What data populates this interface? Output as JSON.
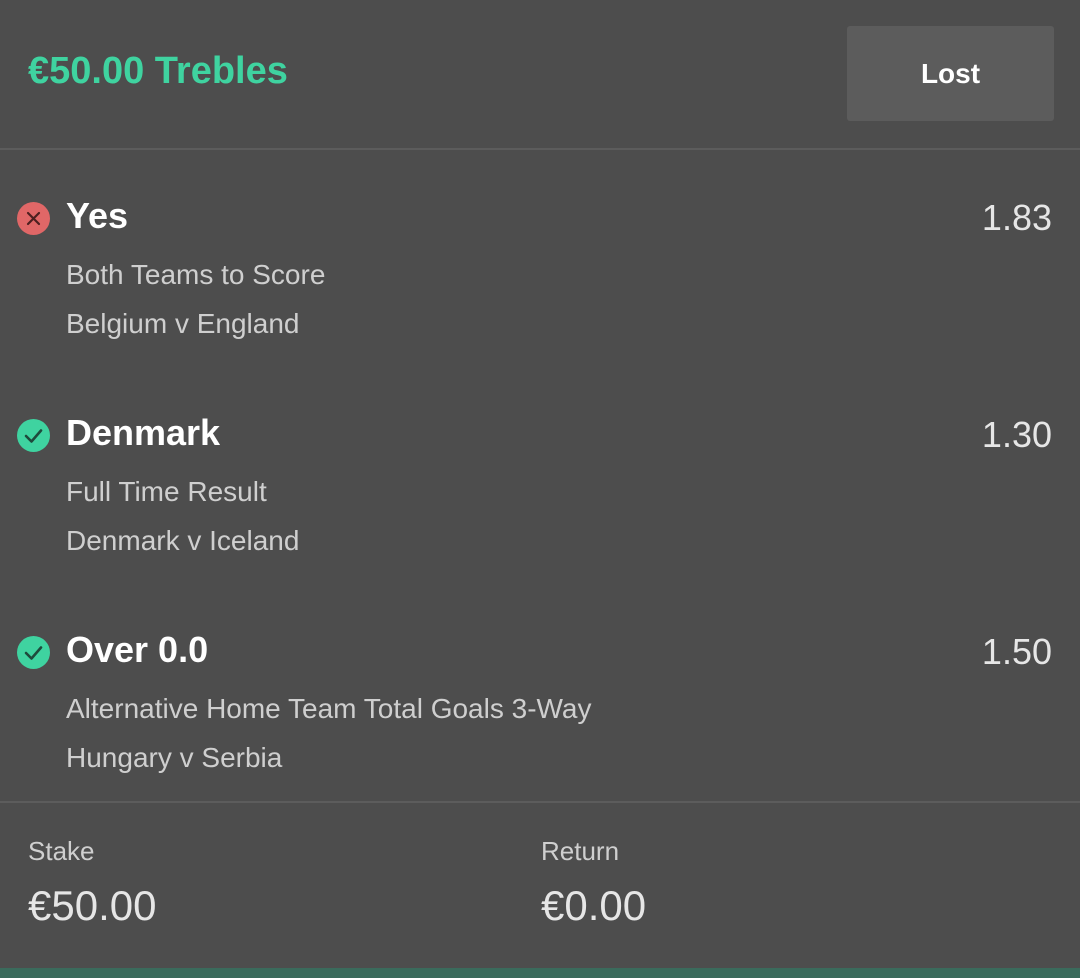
{
  "bet": {
    "title": "€50.00 Trebles",
    "status_label": "Lost"
  },
  "selections": [
    {
      "name": "Yes",
      "odds": "1.83",
      "market": "Both Teams to Score",
      "event": "Belgium v England",
      "result_icon": "lost-x-icon"
    },
    {
      "name": "Denmark",
      "odds": "1.30",
      "market": "Full Time Result",
      "event": "Denmark v Iceland",
      "result_icon": "won-check-icon"
    },
    {
      "name": "Over 0.0",
      "odds": "1.50",
      "market": "Alternative Home Team Total Goals 3-Way",
      "event": "Hungary v Serbia",
      "result_icon": "won-check-icon"
    }
  ],
  "footer": {
    "stake_label": "Stake",
    "stake_value": "€50.00",
    "return_label": "Return",
    "return_value": "€0.00"
  },
  "colors": {
    "background": "#4d4d4d",
    "accent_green": "#3fd3a0",
    "lost_red": "#e06767",
    "button_bg": "#5c5c5c"
  }
}
